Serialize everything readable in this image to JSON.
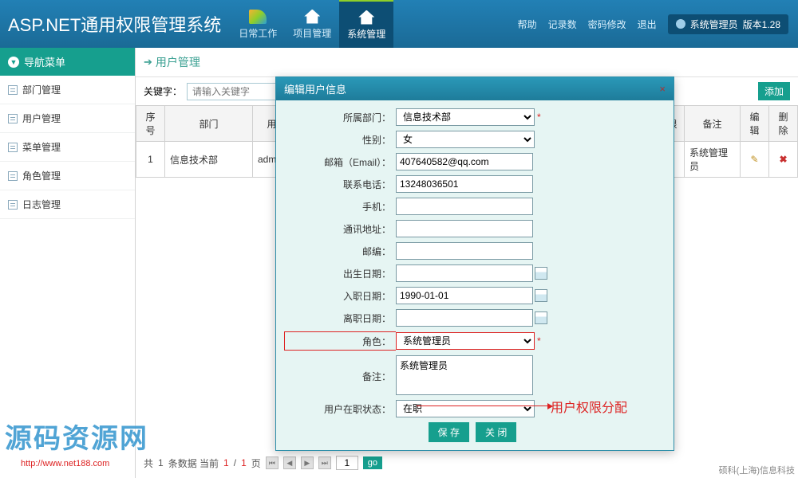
{
  "header": {
    "title": "ASP.NET通用权限管理系统",
    "tabs": [
      {
        "label": "日常工作"
      },
      {
        "label": "项目管理"
      },
      {
        "label": "系统管理"
      }
    ],
    "links": {
      "help": "帮助",
      "records": "记录数",
      "pwd": "密码修改",
      "exit": "退出"
    },
    "user": "系统管理员",
    "version": "版本1.28"
  },
  "sidebar": {
    "title": "导航菜单",
    "items": [
      {
        "label": "部门管理"
      },
      {
        "label": "用户管理"
      },
      {
        "label": "菜单管理"
      },
      {
        "label": "角色管理"
      },
      {
        "label": "日志管理"
      }
    ]
  },
  "page": {
    "title": "用户管理",
    "search_label": "关键字：",
    "search_placeholder": "请输入关键字",
    "add_btn": "添加"
  },
  "table": {
    "headers": {
      "idx": "序号",
      "dept": "部门",
      "user": "用户",
      "role_col": "限",
      "note": "备注",
      "edit": "编辑",
      "del": "删除"
    },
    "rows": [
      {
        "idx": "1",
        "dept": "信息技术部",
        "user": "admin",
        "note": "系统管理员"
      }
    ]
  },
  "pager": {
    "summary_prefix": "共",
    "summary_count": "1",
    "summary_mid": "条数据 当前",
    "page_current": "1",
    "page_sep": "/",
    "page_total": "1",
    "summary_suffix": "页",
    "page_input": "1",
    "go": "go"
  },
  "dialog": {
    "title": "编辑用户信息",
    "close": "×",
    "fields": {
      "dept": {
        "label": "所属部门：",
        "value": "信息技术部"
      },
      "gender": {
        "label": "性别：",
        "value": "女"
      },
      "email": {
        "label": "邮箱（Email）：",
        "value": "407640582@qq.com"
      },
      "phone": {
        "label": "联系电话：",
        "value": "13248036501"
      },
      "mobile": {
        "label": "手机：",
        "value": ""
      },
      "address": {
        "label": "通讯地址：",
        "value": ""
      },
      "zip": {
        "label": "邮编：",
        "value": ""
      },
      "birth": {
        "label": "出生日期：",
        "value": ""
      },
      "hire": {
        "label": "入职日期：",
        "value": "1990-01-01"
      },
      "leave": {
        "label": "离职日期：",
        "value": ""
      },
      "role": {
        "label": "角色：",
        "value": "系统管理员"
      },
      "note": {
        "label": "备注：",
        "value": "系统管理员"
      },
      "status": {
        "label": "用户在职状态：",
        "value": "在职"
      }
    },
    "save": "保 存",
    "close_btn": "关 闭"
  },
  "annotation": "用户权限分配",
  "watermark": {
    "text": "源码资源网",
    "url": "http://www.net188.com"
  },
  "footer": "硕科(上海)信息科技"
}
